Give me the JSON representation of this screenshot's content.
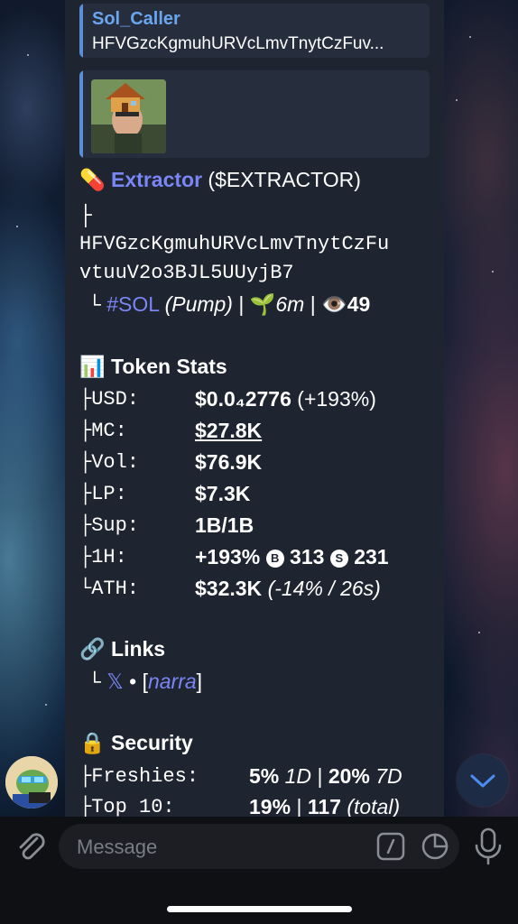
{
  "quote1": {
    "title": "Sol_Caller",
    "text": "HFVGzcKgmuhURVcLmvTnytCzFuv..."
  },
  "token": {
    "pill_icon": "💊",
    "name": "Extractor",
    "ticker": "($EXTRACTOR)",
    "tree_prefix": "├",
    "address_line1": "HFVGzcKgmuhURVcLmvTnytCzFu",
    "address_line2": "vtuuV2o3BJL5UUyjB7",
    "tree_end": "└",
    "chain": "#SOL",
    "platform": "(Pump)",
    "sep": "|",
    "sprout_icon": "🌱",
    "age": "6m",
    "eye_icon": "👁️",
    "views": "49"
  },
  "stats": {
    "icon": "📊",
    "title": "Token Stats",
    "rows": [
      {
        "key": "├USD:",
        "value": "$0.0₄2776",
        "extra": "(+193%)"
      },
      {
        "key": "├MC:",
        "value": "$27.8K"
      },
      {
        "key": "├Vol:",
        "value": "$76.9K"
      },
      {
        "key": "├LP:",
        "value": "$7.3K"
      },
      {
        "key": "├Sup:",
        "value": "1B/1B"
      },
      {
        "key": "├1H:",
        "value": "+193%",
        "buy_icon": "B",
        "buys": "313",
        "sell_icon": "S",
        "sells": "231"
      },
      {
        "key": "└ATH:",
        "value": "$32.3K",
        "extra": "(-14% / 26s)"
      }
    ]
  },
  "links": {
    "icon": "🔗",
    "title": "Links",
    "tree": "└",
    "x_label": "𝕏",
    "dot": "•",
    "bracket_open": "[",
    "narra": "narra",
    "bracket_close": "]"
  },
  "security": {
    "icon": "🔒",
    "title": "Security",
    "freshies_key": "├Freshies:",
    "freshies_1d": "5%",
    "freshies_1d_label": "1D",
    "freshies_7d": "20%",
    "freshies_7d_label": "7D",
    "top10_key": "├Top 10:",
    "top10_pct": "19%",
    "top10_total": "117",
    "top10_total_label": "(total)",
    "sep": "|"
  },
  "composer": {
    "placeholder": "Message"
  },
  "colors": {
    "accent": "#7a86f5",
    "quote_bar": "#5a8fd8",
    "bubble": "#1e2430"
  }
}
